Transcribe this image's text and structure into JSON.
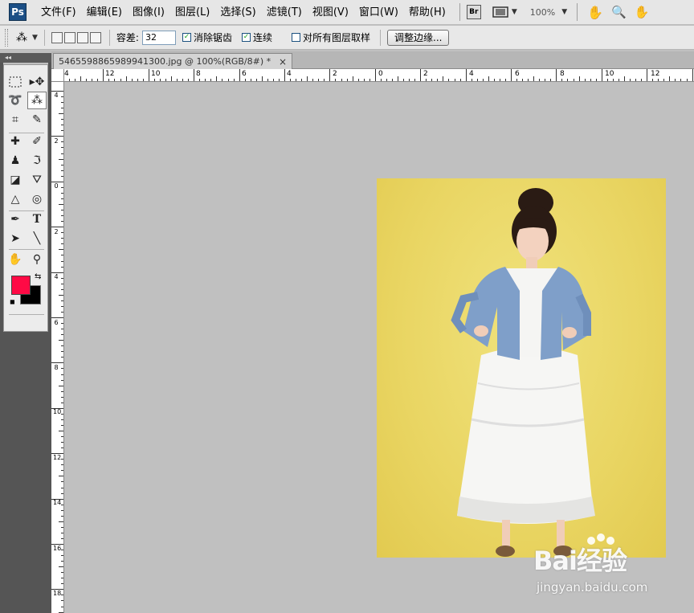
{
  "app": {
    "logo": "Ps"
  },
  "menu": {
    "items": [
      "文件(F)",
      "编辑(E)",
      "图像(I)",
      "图层(L)",
      "选择(S)",
      "滤镜(T)",
      "视图(V)",
      "窗口(W)",
      "帮助(H)"
    ],
    "bridge_label": "Br",
    "zoom": "100%"
  },
  "options": {
    "tolerance_label": "容差:",
    "tolerance_value": "32",
    "antialias_label": "消除锯齿",
    "antialias_checked": true,
    "contiguous_label": "连续",
    "contiguous_checked": true,
    "sample_all_label": "对所有图层取样",
    "sample_all_checked": false,
    "refine_edge_label": "调整边缘..."
  },
  "toolbox": {
    "collapse_label": "◂◂",
    "foreground_color": "#ff0a45",
    "background_color": "#000000"
  },
  "document": {
    "tab_title": "5465598865989941300.jpg @ 100%(RGB/8#) *",
    "close_symbol": "×"
  },
  "ruler": {
    "h_labels": [
      "4",
      "12",
      "10",
      "8",
      "6",
      "4",
      "2",
      "0",
      "2",
      "4",
      "6",
      "8",
      "10",
      "12"
    ],
    "v_labels": [
      "4",
      "2",
      "0",
      "2",
      "4",
      "6",
      "8",
      "10",
      "12",
      "14",
      "16",
      "18"
    ]
  },
  "watermark": {
    "main": "Bai经验",
    "sub": "jingyan.baidu.com"
  }
}
